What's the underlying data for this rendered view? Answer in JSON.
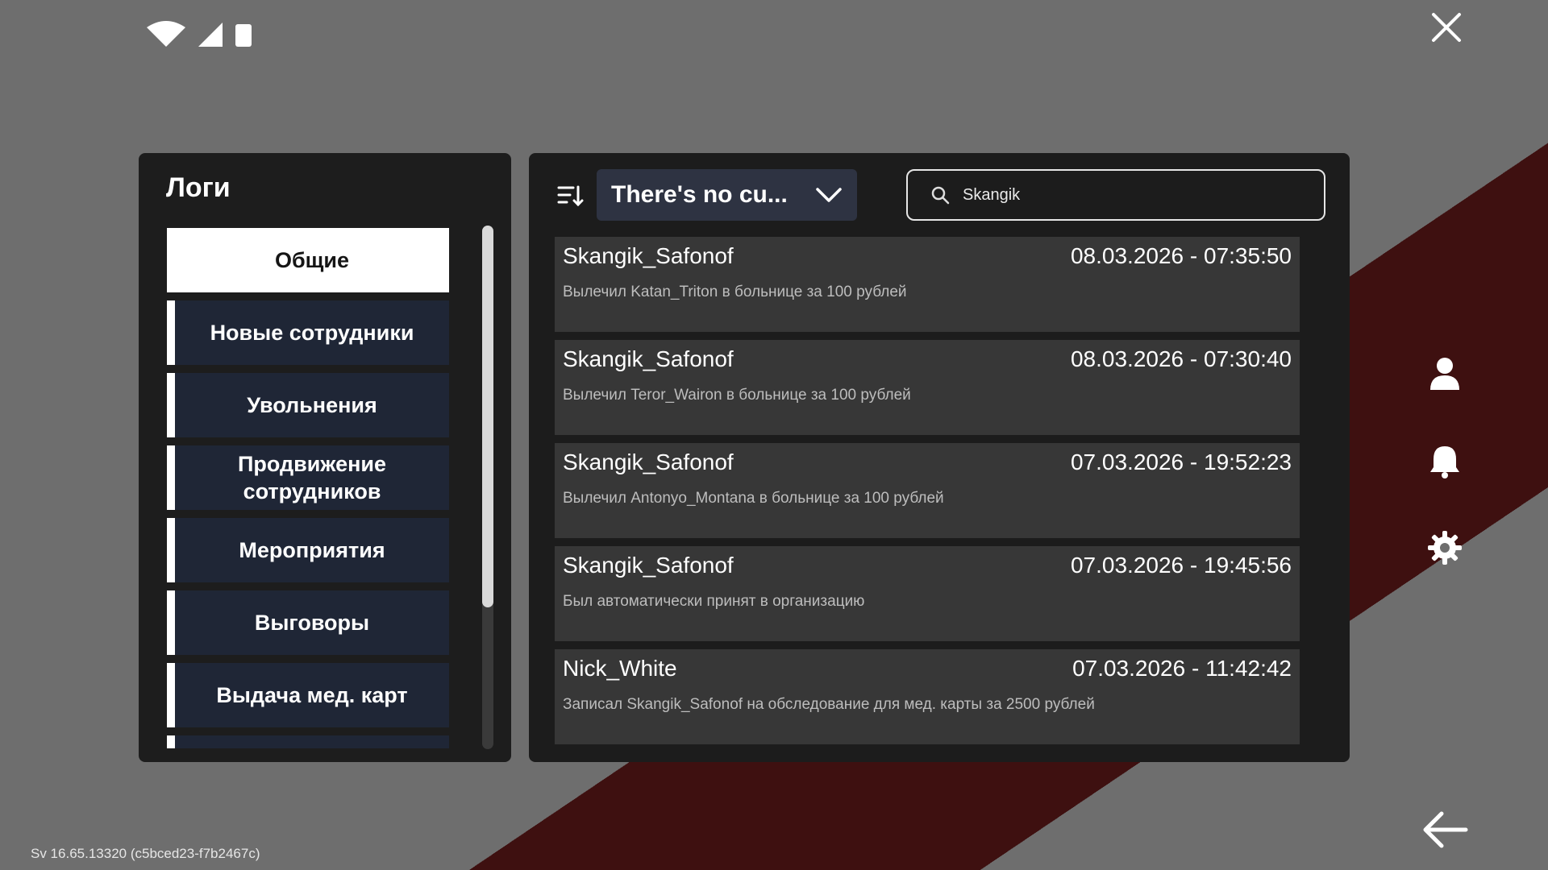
{
  "colors": {
    "panel_bg": "#1d1d1d",
    "category_bg": "#1f2636",
    "dropdown_bg": "#2e3342",
    "accent_white": "#ffffff",
    "log_bg": "#3c3c3c"
  },
  "status": {
    "icons": [
      "wifi-icon",
      "signal-icon",
      "battery-icon"
    ]
  },
  "version": "Sv 16.65.13320 (c5bced23-f7b2467c)",
  "sidebar": {
    "title": "Логи",
    "items": [
      {
        "label": "Общие",
        "active": true
      },
      {
        "label": "Новые сотрудники",
        "active": false
      },
      {
        "label": "Увольнения",
        "active": false
      },
      {
        "label": "Продвижение сотрудников",
        "active": false
      },
      {
        "label": "Мероприятия",
        "active": false
      },
      {
        "label": "Выговоры",
        "active": false
      },
      {
        "label": "Выдача мед. карт",
        "active": false
      },
      {
        "label": "",
        "active": false
      }
    ]
  },
  "toolbar": {
    "sort_icon": "sort-icon",
    "dropdown_value": "There's no cu...",
    "search_value": "Skangik"
  },
  "logs": [
    {
      "user": "Skangik_Safonof",
      "time": "08.03.2026 - 07:35:50",
      "desc": "Вылечил Katan_Triton в больнице за 100 рублей"
    },
    {
      "user": "Skangik_Safonof",
      "time": "08.03.2026 - 07:30:40",
      "desc": "Вылечил Teror_Wairon в больнице за 100 рублей"
    },
    {
      "user": "Skangik_Safonof",
      "time": "07.03.2026 - 19:52:23",
      "desc": "Вылечил Antonyo_Montana в больнице за 100 рублей"
    },
    {
      "user": "Skangik_Safonof",
      "time": "07.03.2026 - 19:45:56",
      "desc": "Был автоматически принят в организацию"
    },
    {
      "user": "Nick_White",
      "time": "07.03.2026 - 11:42:42",
      "desc": "Записал Skangik_Safonof на обследование для мед. карты за 2500 рублей"
    }
  ],
  "right_rail": [
    "user-icon",
    "bell-icon",
    "gear-icon"
  ]
}
